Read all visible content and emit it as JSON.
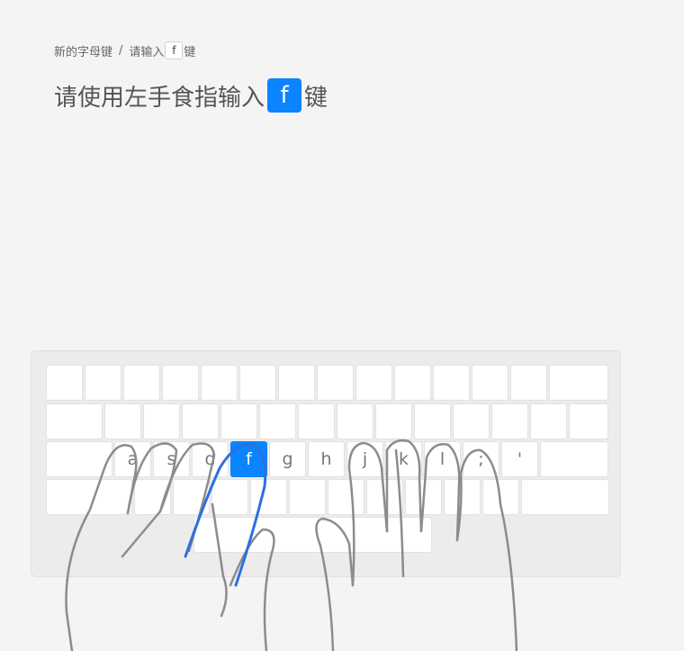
{
  "breadcrumb": {
    "parent": "新的字母键",
    "separator": "/",
    "current_prefix": "请输入",
    "current_key": "f",
    "current_suffix": "键"
  },
  "title": {
    "prefix": "请使用左手食指输入",
    "key": "f",
    "suffix": "键"
  },
  "keyboard": {
    "target_key": "f",
    "home_row_labels": [
      "a",
      "s",
      "d",
      "f",
      "g",
      "h",
      "j",
      "k",
      "l",
      ";",
      "'"
    ],
    "target_color": "#0a84ff",
    "guide_finger": "left index finger"
  },
  "colors": {
    "background": "#f4f4f4",
    "accent": "#0a84ff",
    "finger_outline": "#8c8c8c",
    "finger_highlight": "#2e6fe0"
  }
}
